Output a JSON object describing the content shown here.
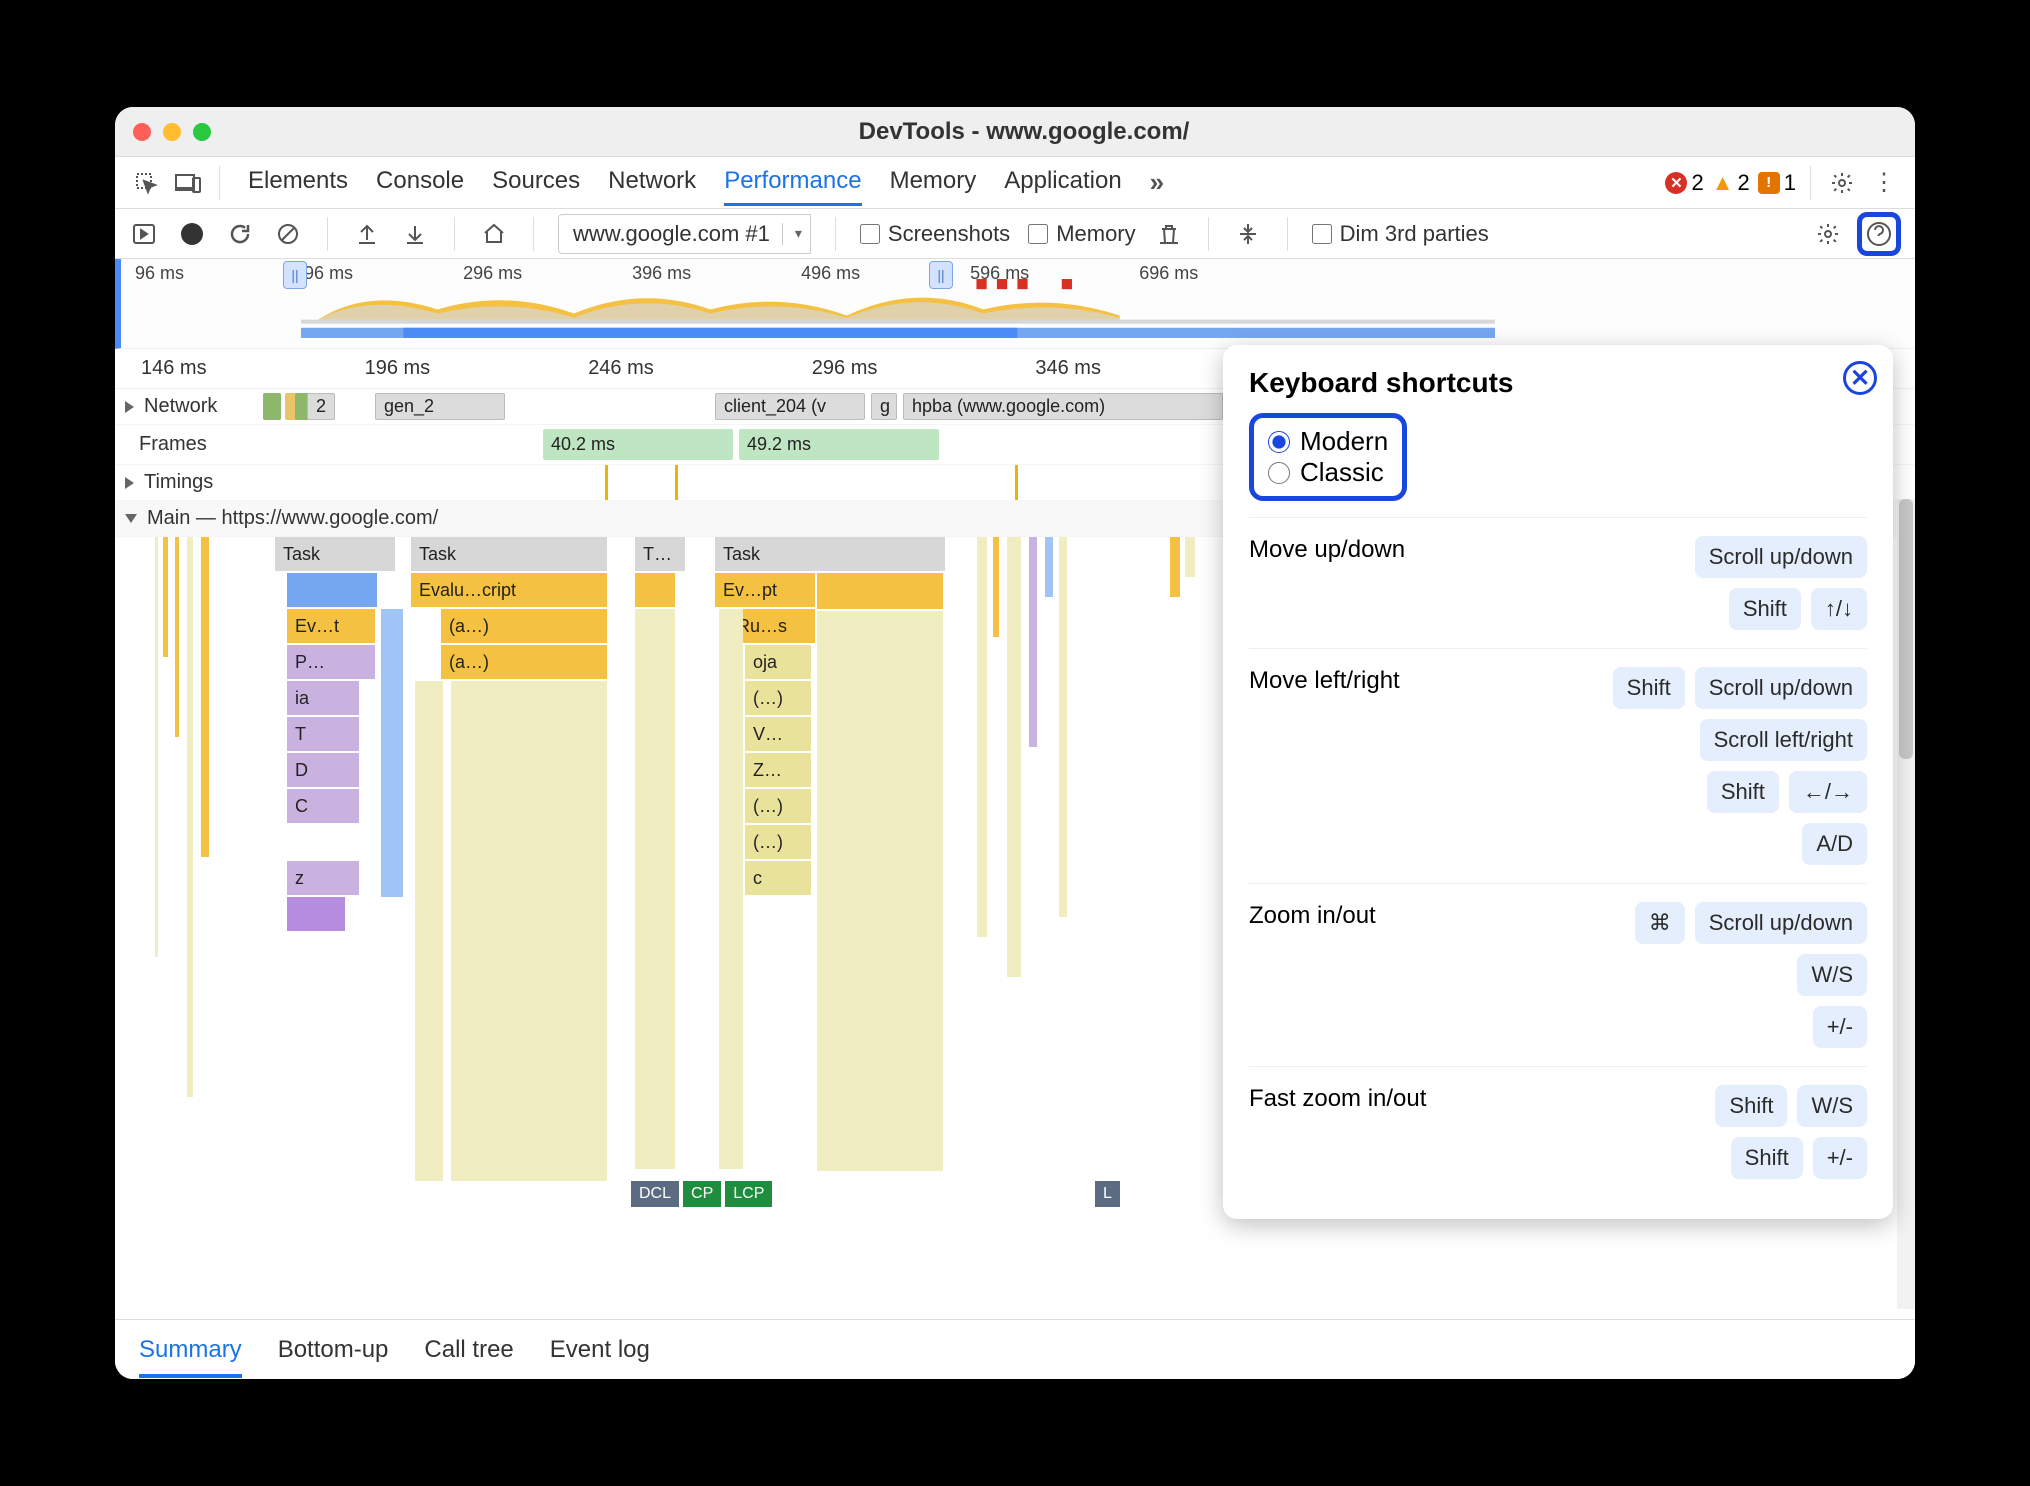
{
  "window": {
    "title": "DevTools - www.google.com/"
  },
  "tabs": {
    "items": [
      "Elements",
      "Console",
      "Sources",
      "Network",
      "Performance",
      "Memory",
      "Application"
    ],
    "activeIndex": 4
  },
  "badges": {
    "errors": 2,
    "warnings": 2,
    "issues": 1
  },
  "toolbar": {
    "urlSelect": "www.google.com #1",
    "screenshots_label": "Screenshots",
    "memory_label": "Memory",
    "dim_label": "Dim 3rd parties"
  },
  "overview": {
    "ticks": [
      "96 ms",
      "196 ms",
      "296 ms",
      "396 ms",
      "496 ms",
      "596 ms",
      "696 ms"
    ]
  },
  "ruler": {
    "ticks": [
      "146 ms",
      "196 ms",
      "246 ms",
      "296 ms",
      "346 ms"
    ]
  },
  "tracks": {
    "network": {
      "label": "Network",
      "items": [
        "2",
        "gen_2",
        "client_204 (v",
        "g",
        "hpba (www.google.com)"
      ]
    },
    "frames": {
      "label": "Frames",
      "items": [
        "40.2 ms",
        "49.2 ms"
      ]
    },
    "timings": {
      "label": "Timings"
    },
    "main": {
      "label": "Main — https://www.google.com/"
    }
  },
  "flame": {
    "row0": [
      "Task",
      "Task",
      "T…",
      "Task"
    ],
    "row1": [
      "Ev…t",
      "Evalu…cript",
      "Ev…pt"
    ],
    "row2": [
      "(a…)",
      "Ru…s"
    ],
    "row3": [
      "P…",
      "(a…)",
      "oja"
    ],
    "row4_labels": [
      "(…)",
      "V…",
      "Z…",
      "(…)",
      "(…)",
      "c"
    ],
    "left_stack": [
      "ia",
      "T",
      "D",
      "C",
      "",
      "z"
    ]
  },
  "markers": {
    "dcl": "DCL",
    "cp": "CP",
    "lcp": "LCP",
    "l": "L"
  },
  "bottom_tabs": {
    "items": [
      "Summary",
      "Bottom-up",
      "Call tree",
      "Event log"
    ],
    "activeIndex": 0
  },
  "popover": {
    "title": "Keyboard shortcuts",
    "radios": [
      "Modern",
      "Classic"
    ],
    "rows": [
      {
        "label": "Move up/down",
        "keys": [
          [
            "Scroll up/down"
          ],
          [
            "Shift",
            "↑/↓"
          ]
        ]
      },
      {
        "label": "Move left/right",
        "keys": [
          [
            "Shift",
            "Scroll up/down"
          ],
          [
            "Scroll left/right"
          ],
          [
            "Shift",
            "←/→"
          ],
          [
            "A/D"
          ]
        ]
      },
      {
        "label": "Zoom in/out",
        "keys": [
          [
            "⌘",
            "Scroll up/down"
          ],
          [
            "W/S"
          ],
          [
            "+/-"
          ]
        ]
      },
      {
        "label": "Fast zoom in/out",
        "keys": [
          [
            "Shift",
            "W/S"
          ],
          [
            "Shift",
            "+/-"
          ]
        ]
      }
    ]
  },
  "colors": {
    "task_gray": "#d7d7d7",
    "script_yellow": "#f4c142",
    "layout_purple": "#c9b1e0",
    "frame_green": "#bfe6c2",
    "accent": "#1a73e8",
    "dcl": "#5b6c82",
    "lcp": "#1e8e3e",
    "paleyellow": "#f0eec1"
  }
}
